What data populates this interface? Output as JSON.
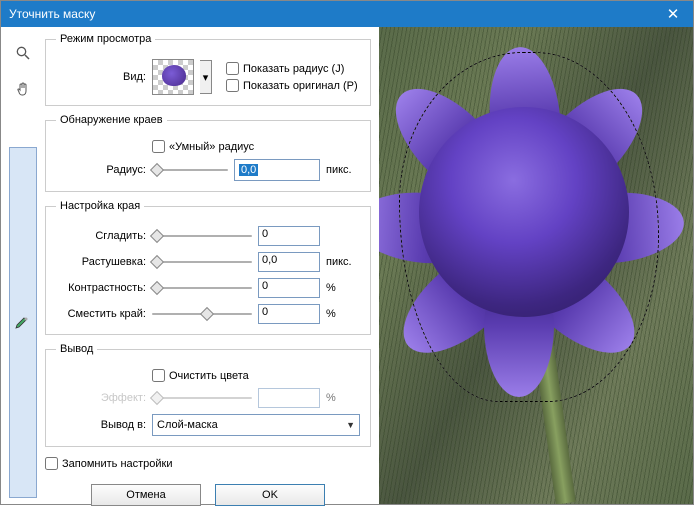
{
  "window": {
    "title": "Уточнить маску"
  },
  "viewMode": {
    "legend": "Режим просмотра",
    "viewLabel": "Вид:",
    "showRadius": "Показать радиус (J)",
    "showOriginal": "Показать оригинал (P)"
  },
  "edgeDetect": {
    "legend": "Обнаружение краев",
    "smartRadius": "«Умный» радиус",
    "radiusLabel": "Радиус:",
    "radiusValue": "0,0",
    "radiusUnit": "пикс."
  },
  "adjust": {
    "legend": "Настройка края",
    "smoothLabel": "Сгладить:",
    "smoothValue": "0",
    "featherLabel": "Растушевка:",
    "featherValue": "0,0",
    "featherUnit": "пикс.",
    "contrastLabel": "Контрастность:",
    "contrastValue": "0",
    "contrastUnit": "%",
    "shiftLabel": "Сместить край:",
    "shiftValue": "0",
    "shiftUnit": "%"
  },
  "output": {
    "legend": "Вывод",
    "decontaminate": "Очистить цвета",
    "amountLabel": "Эффект:",
    "amountUnit": "%",
    "outputToLabel": "Вывод в:",
    "outputToValue": "Слой-маска"
  },
  "remember": "Запомнить настройки",
  "buttons": {
    "cancel": "Отмена",
    "ok": "OK"
  }
}
